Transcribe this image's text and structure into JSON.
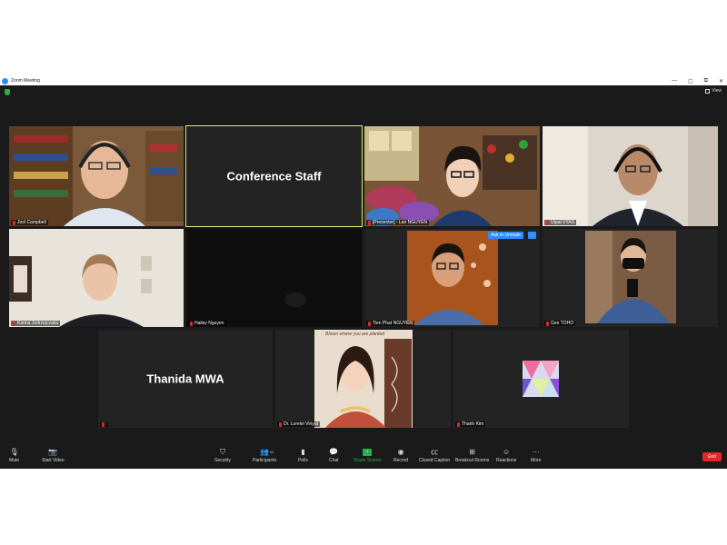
{
  "window": {
    "title": "Zoom Meeting",
    "controls": [
      "—",
      "▢",
      "⧉",
      "✕"
    ]
  },
  "header": {
    "view_label": "View"
  },
  "tiles": [
    {
      "name": "Joel Campbell",
      "muted": true
    },
    {
      "name": "Conference Staff",
      "muted": false,
      "display_name": "Conference Staff"
    },
    {
      "name": "[Presenter] - Lan NGUYEN",
      "muted": true
    },
    {
      "name": "Utpal VYAS",
      "muted": true
    },
    {
      "name": "Karina Jedrzejczaka",
      "muted": true
    },
    {
      "name": "Hailey Nguyen",
      "muted": true
    },
    {
      "name": "Tien Phat NGUYEN",
      "muted": true
    },
    {
      "name": "Gen TOHO",
      "muted": true
    },
    {
      "name": "",
      "muted": true,
      "display_name": "Thanida MWA"
    },
    {
      "name": "Dr. Lorelei Viriyat",
      "muted": true,
      "caption": "Bloom where you are planted"
    },
    {
      "name": "Thanh Kim",
      "muted": true
    }
  ],
  "tile_actions": {
    "ask_unmute": "Ask to Unmute",
    "more": "···"
  },
  "toolbar": {
    "mute": "Mute",
    "start_video": "Start Video",
    "security": "Security",
    "participants": "Participants",
    "participants_count": "11",
    "polls": "Polls",
    "chat": "Chat",
    "share_screen": "Share Screen",
    "record": "Record",
    "closed_caption": "Closed Caption",
    "breakout_rooms": "Breakout Rooms",
    "reactions": "Reactions",
    "more": "More",
    "end": "End"
  },
  "colors": {
    "background": "#1a1a1a",
    "active_speaker_border": "#d6f26b",
    "accent_blue": "#2d8cff",
    "share_green": "#26b24b",
    "end_red": "#e02828",
    "muted_red": "#e02828"
  }
}
